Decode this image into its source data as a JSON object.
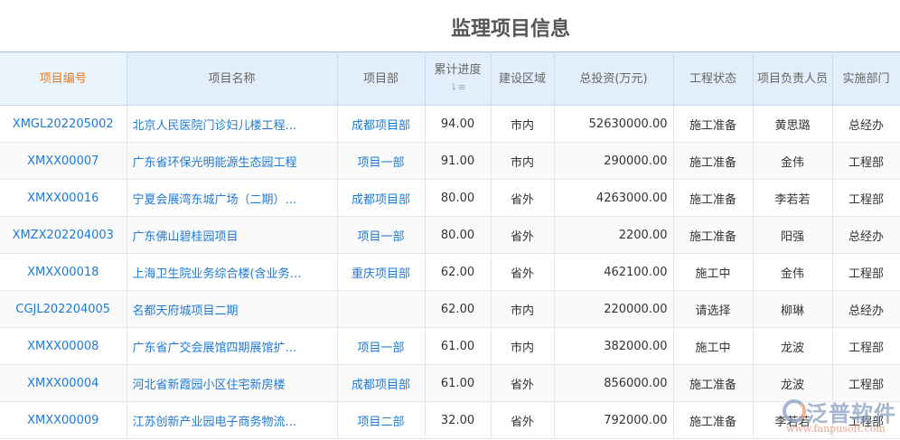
{
  "title": "监理项目信息",
  "columns": [
    "项目编号",
    "项目名称",
    "项目部",
    "累计进度",
    "建设区域",
    "总投资(万元)",
    "工程状态",
    "项目负责人员",
    "实施部门"
  ],
  "rows": [
    {
      "id": "XMGL202205002",
      "name": "北京人民医院门诊妇儿楼工程…",
      "dept": "成都项目部",
      "progress": "94.00",
      "area": "市内",
      "invest": "52630000.00",
      "status": "施工准备",
      "owner": "黄思璐",
      "impl": "总经办"
    },
    {
      "id": "XMXX00007",
      "name": "广东省环保光明能源生态园工程",
      "dept": "项目一部",
      "progress": "91.00",
      "area": "市内",
      "invest": "290000.00",
      "status": "施工准备",
      "owner": "金伟",
      "impl": "工程部"
    },
    {
      "id": "XMXX00016",
      "name": "宁夏会展湾东城广场（二期）…",
      "dept": "成都项目部",
      "progress": "80.00",
      "area": "省外",
      "invest": "4263000.00",
      "status": "施工准备",
      "owner": "李若若",
      "impl": "工程部"
    },
    {
      "id": "XMZX202204003",
      "name": "广东佛山碧桂园项目",
      "dept": "项目一部",
      "progress": "80.00",
      "area": "省外",
      "invest": "2200.00",
      "status": "施工准备",
      "owner": "阳强",
      "impl": "总经办"
    },
    {
      "id": "XMXX00018",
      "name": "上海卫生院业务综合楼(含业务…",
      "dept": "重庆项目部",
      "progress": "62.00",
      "area": "省外",
      "invest": "462100.00",
      "status": "施工中",
      "owner": "金伟",
      "impl": "工程部"
    },
    {
      "id": "CGJL202204005",
      "name": "名都天府城项目二期",
      "dept": "",
      "progress": "62.00",
      "area": "市内",
      "invest": "220000.00",
      "status": "请选择",
      "owner": "柳琳",
      "impl": "总经办"
    },
    {
      "id": "XMXX00008",
      "name": "广东省广交会展馆四期展馆扩…",
      "dept": "项目一部",
      "progress": "61.00",
      "area": "市内",
      "invest": "382000.00",
      "status": "施工中",
      "owner": "龙波",
      "impl": "工程部"
    },
    {
      "id": "XMXX00004",
      "name": "河北省新霞园小区住宅新房楼",
      "dept": "成都项目部",
      "progress": "61.00",
      "area": "省外",
      "invest": "856000.00",
      "status": "施工准备",
      "owner": "龙波",
      "impl": "工程部"
    },
    {
      "id": "XMXX00009",
      "name": "江苏创新产业园电子商务物流…",
      "dept": "项目二部",
      "progress": "32.00",
      "area": "省外",
      "invest": "792000.00",
      "status": "施工准备",
      "owner": "李若若",
      "impl": "工程部"
    }
  ],
  "watermark": {
    "brand": "泛普软件",
    "url": "www.fanpusoft.com"
  }
}
